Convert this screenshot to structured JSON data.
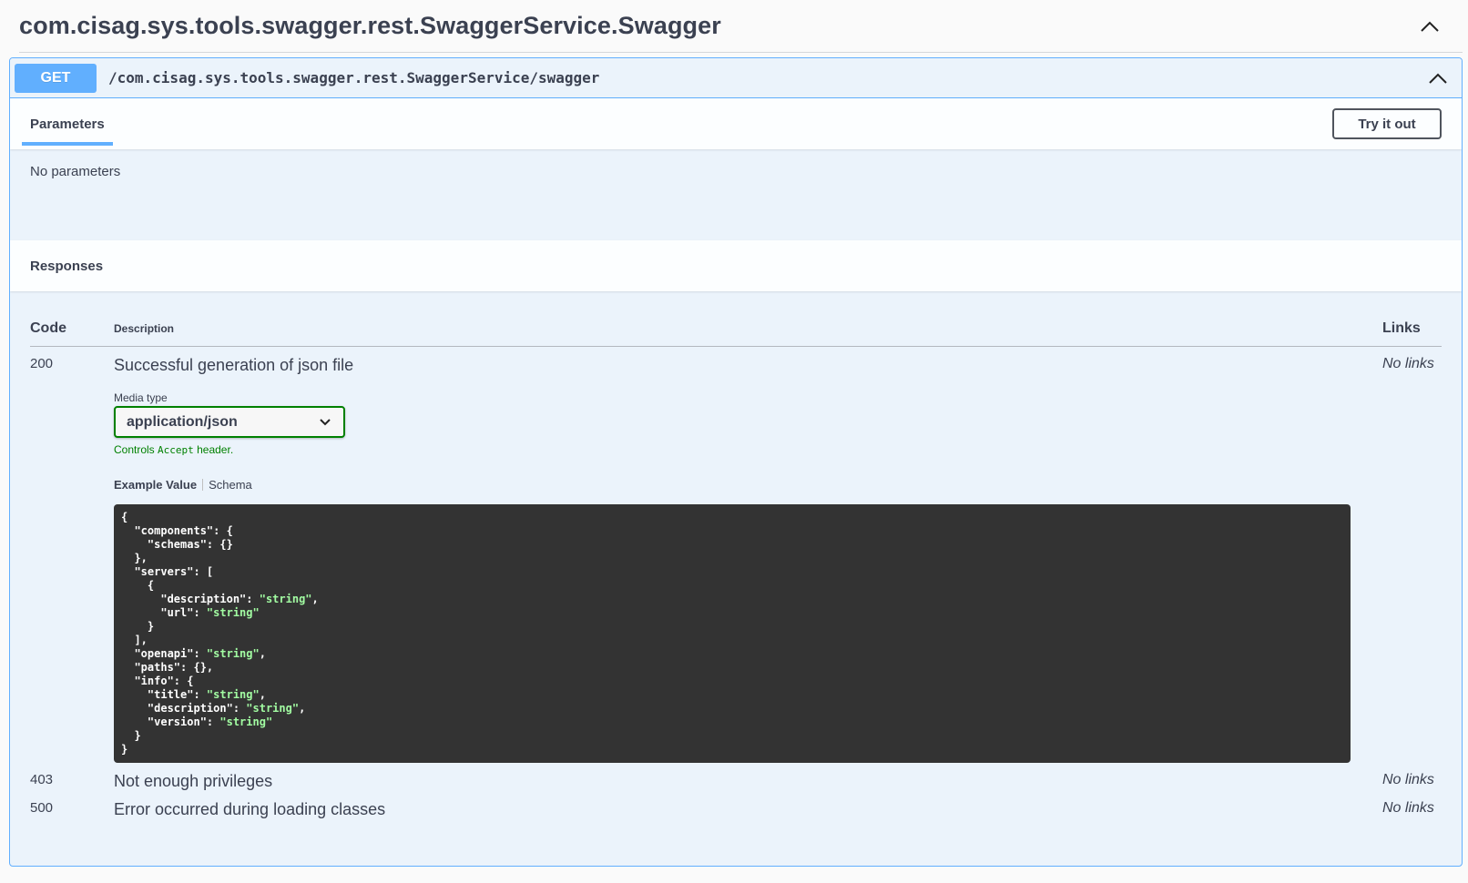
{
  "tag": {
    "title": "com.cisag.sys.tools.swagger.rest.SwaggerService.Swagger",
    "collapse_icon": "chevron-up-icon"
  },
  "operation": {
    "method": "GET",
    "path": "/com.cisag.sys.tools.swagger.rest.SwaggerService/swagger",
    "colors": {
      "method_bg": "#61affe",
      "block_bg": "#ebf3fb"
    }
  },
  "parameters": {
    "tab_label": "Parameters",
    "try_button": "Try it out",
    "empty_text": "No parameters"
  },
  "responses": {
    "title": "Responses",
    "columns": {
      "code": "Code",
      "description": "Description",
      "links": "Links"
    },
    "items": [
      {
        "code": "200",
        "description": "Successful generation of json file",
        "links": "No links",
        "media_type_label": "Media type",
        "media_type_value": "application/json",
        "controls_prefix": "Controls ",
        "controls_code": "Accept",
        "controls_suffix": " header.",
        "example_tab": "Example Value",
        "schema_tab": "Schema"
      },
      {
        "code": "403",
        "description": "Not enough privileges",
        "links": "No links"
      },
      {
        "code": "500",
        "description": "Error occurred during loading classes",
        "links": "No links"
      }
    ],
    "example_lines": [
      [
        {
          "t": "{"
        }
      ],
      [
        {
          "t": "  \"components\": {"
        }
      ],
      [
        {
          "t": "    \"schemas\": {}"
        }
      ],
      [
        {
          "t": "  },"
        }
      ],
      [
        {
          "t": "  \"servers\": ["
        }
      ],
      [
        {
          "t": "    {"
        }
      ],
      [
        {
          "t": "      \"description\": "
        },
        {
          "t": "\"string\"",
          "s": 1
        },
        {
          "t": ","
        }
      ],
      [
        {
          "t": "      \"url\": "
        },
        {
          "t": "\"string\"",
          "s": 1
        }
      ],
      [
        {
          "t": "    }"
        }
      ],
      [
        {
          "t": "  ],"
        }
      ],
      [
        {
          "t": "  \"openapi\": "
        },
        {
          "t": "\"string\"",
          "s": 1
        },
        {
          "t": ","
        }
      ],
      [
        {
          "t": "  \"paths\": {},"
        }
      ],
      [
        {
          "t": "  \"info\": {"
        }
      ],
      [
        {
          "t": "    \"title\": "
        },
        {
          "t": "\"string\"",
          "s": 1
        },
        {
          "t": ","
        }
      ],
      [
        {
          "t": "    \"description\": "
        },
        {
          "t": "\"string\"",
          "s": 1
        },
        {
          "t": ","
        }
      ],
      [
        {
          "t": "    \"version\": "
        },
        {
          "t": "\"string\"",
          "s": 1
        }
      ],
      [
        {
          "t": "  }"
        }
      ],
      [
        {
          "t": "}"
        }
      ]
    ]
  }
}
